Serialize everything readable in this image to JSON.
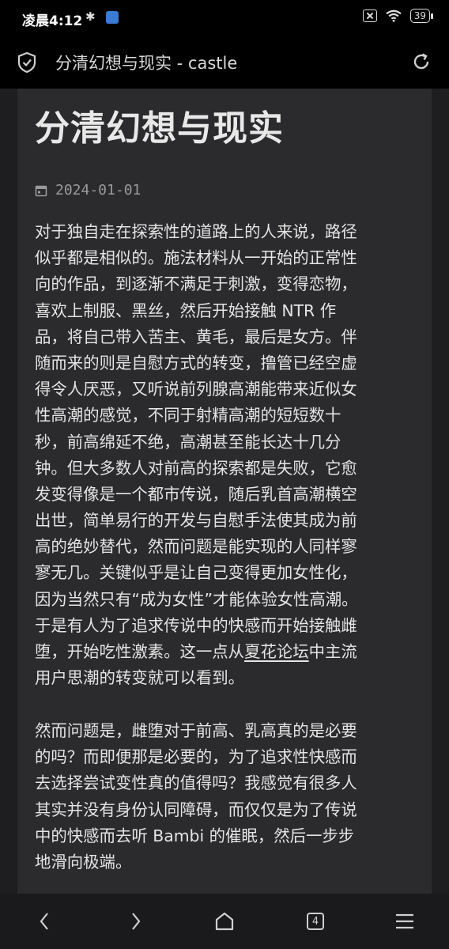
{
  "status_bar": {
    "time": "凌晨4:12",
    "battery": "39"
  },
  "app_bar": {
    "title": "分清幻想与现实 - castle"
  },
  "post": {
    "title": "分清幻想与现实",
    "date": "2024-01-01",
    "paragraph1_lines": [
      "对于独自走在探索性的道路上的人来说，路径",
      "似乎都是相似的。施法材料从一开始的正常性",
      "向的作品，到逐渐不满足于刺激，变得恋物，",
      "喜欢上制服、黑丝，然后开始接触 NTR 作",
      "品，将自己带入苦主、黄毛，最后是女方。伴",
      "随而来的则是自慰方式的转变，撸管已经空虚",
      "得令人厌恶，又听说前列腺高潮能带来近似女",
      "性高潮的感觉，不同于射精高潮的短短数十",
      "秒，前高绵延不绝，高潮甚至能长达十几分",
      "钟。但大多数人对前高的探索都是失败，它愈",
      "发变得像是一个都市传说，随后乳首高潮横空",
      "出世，简单易行的开发与自慰手法使其成为前",
      "高的绝妙替代，然而问题是能实现的人同样寥",
      "寥无几。关键似乎是让自己变得更加女性化，",
      "因为当然只有“成为女性”才能体验女性高潮。",
      "于是有人为了追求传说中的快感而开始接触雌",
      "堕，开始吃性激素。这一点从",
      "中主流",
      "用户思潮的转变就可以看到。"
    ],
    "link_text": "夏花论坛",
    "paragraph2_lines": [
      "然而问题是，雌堕对于前高、乳高真的是必要",
      "的吗？而即便那是必要的，为了追求性快感而",
      "去选择尝试变性真的值得吗？我感觉有很多人",
      "其实并没有身份认同障碍，而仅仅是为了传说",
      "中的快感而去听 Bambi 的催眠，然后一步步",
      "地滑向极端。"
    ]
  },
  "nav_bar": {
    "tab_count": "4"
  },
  "icons": {
    "app_bar_left": "shield-check-icon",
    "app_bar_right": "refresh-icon",
    "date": "calendar-icon",
    "nav": [
      "back-icon",
      "forward-icon",
      "home-icon",
      "tabs-icon",
      "menu-icon"
    ]
  }
}
